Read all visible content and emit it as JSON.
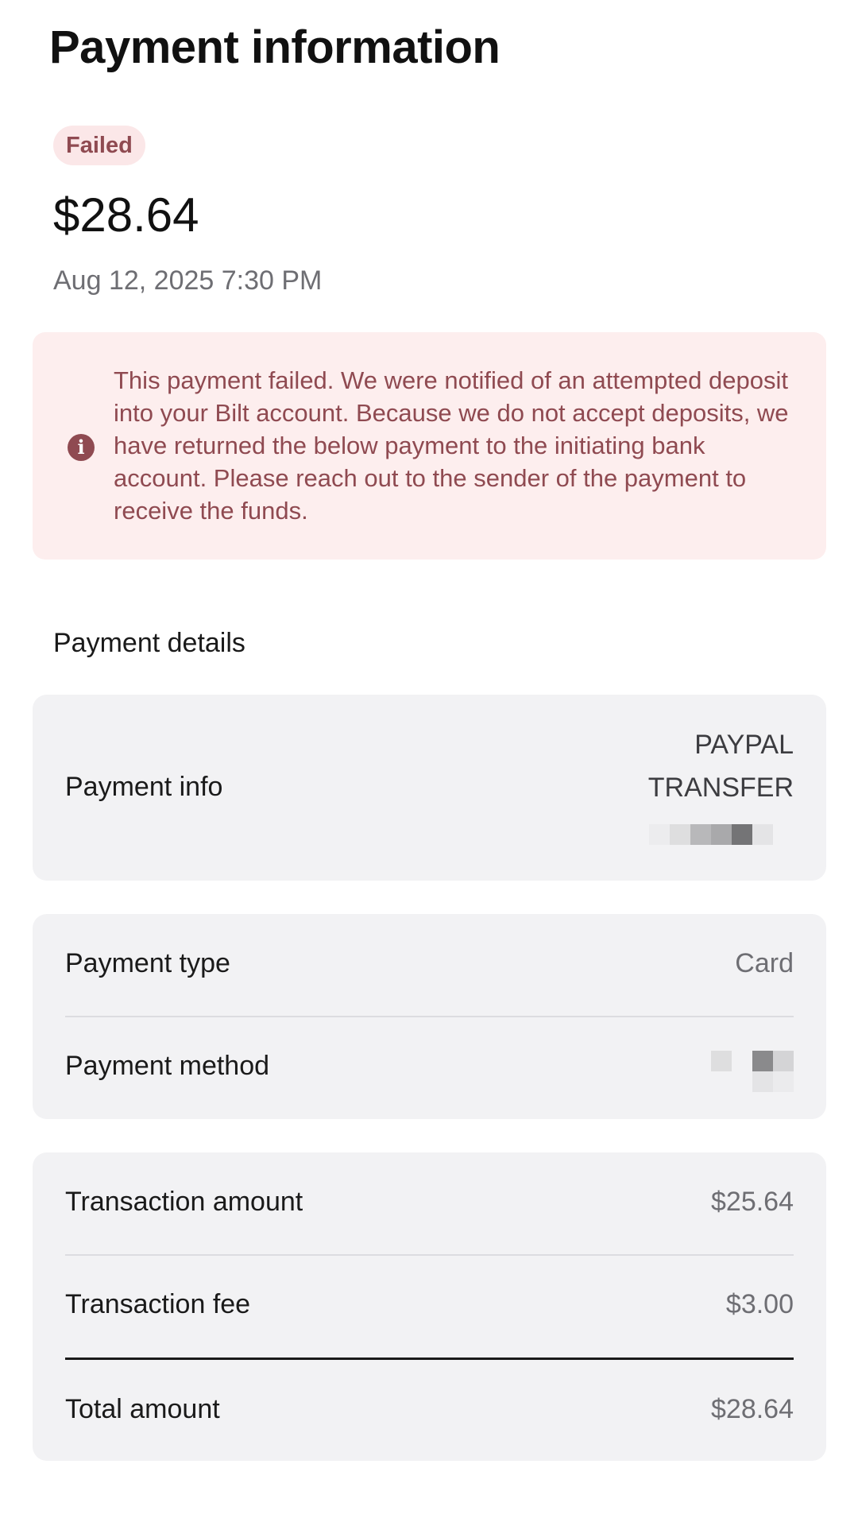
{
  "header": {
    "title": "Payment information"
  },
  "summary": {
    "status": "Failed",
    "amount": "$28.64",
    "date": "Aug 12, 2025 7:30 PM"
  },
  "alert": {
    "icon": "info-icon",
    "message": "This payment failed. We were notified of an attempted deposit into your Bilt account. Because we do not accept deposits, we have returned the below payment to the initiating bank account. Please reach out to the sender of the payment to receive the funds."
  },
  "details": {
    "heading": "Payment details",
    "payment_info": {
      "label": "Payment info",
      "value_line1": "PAYPAL",
      "value_line2": "TRANSFER"
    },
    "payment_type": {
      "label": "Payment type",
      "value": "Card"
    },
    "payment_method": {
      "label": "Payment method"
    },
    "transaction_amount": {
      "label": "Transaction amount",
      "value": "$25.64"
    },
    "transaction_fee": {
      "label": "Transaction fee",
      "value": "$3.00"
    },
    "total_amount": {
      "label": "Total amount",
      "value": "$28.64"
    }
  },
  "colors": {
    "failed_text": "#8f4a51",
    "failed_bg": "#fdeeee",
    "card_bg": "#f2f2f4"
  }
}
